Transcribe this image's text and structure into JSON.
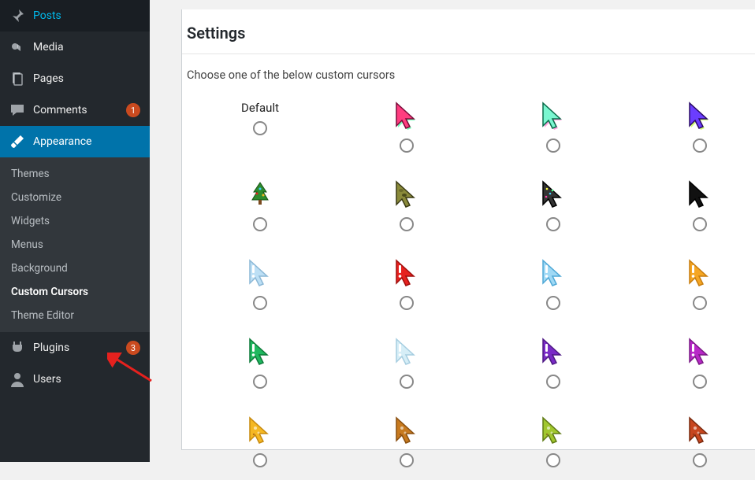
{
  "sidebar": {
    "posts": "Posts",
    "media": "Media",
    "pages": "Pages",
    "comments": "Comments",
    "comments_badge": "1",
    "appearance": "Appearance",
    "plugins": "Plugins",
    "plugins_badge": "3",
    "users": "Users",
    "submenu": {
      "themes": "Themes",
      "customize": "Customize",
      "widgets": "Widgets",
      "menus": "Menus",
      "background": "Background",
      "custom_cursors": "Custom Cursors",
      "theme_editor": "Theme Editor"
    }
  },
  "settings": {
    "title": "Settings",
    "subtitle": "Choose one of the below custom cursors",
    "default_label": "Default",
    "cursors": [
      {
        "id": "default",
        "label": "Default"
      },
      {
        "id": "pink-neon",
        "fill": "#ff3d7f",
        "stroke": "#7a0b3a",
        "shadow": "#3aff9e"
      },
      {
        "id": "mint-neon",
        "fill": "#7af7d0",
        "stroke": "#0b6b4a",
        "shadow": "#ff7ad0"
      },
      {
        "id": "purple-neon",
        "fill": "#6b3dff",
        "stroke": "#2a0b66",
        "shadow": "#bfff3a"
      },
      {
        "id": "tree",
        "fill": "#2e8b2e",
        "stroke": "#145214",
        "decor": "tree"
      },
      {
        "id": "camo",
        "fill": "#8a8a3a",
        "stroke": "#3a3a14",
        "decor": "camo"
      },
      {
        "id": "confetti",
        "fill": "#333333",
        "stroke": "#000000",
        "decor": "confetti"
      },
      {
        "id": "black",
        "fill": "#111111",
        "stroke": "#000000"
      },
      {
        "id": "ex-lightblue",
        "fill": "#bcdff5",
        "stroke": "#8cb8d6",
        "decor": "excl"
      },
      {
        "id": "ex-red",
        "fill": "#e6211e",
        "stroke": "#a00f0d",
        "decor": "excl"
      },
      {
        "id": "ex-sky",
        "fill": "#9fd9f5",
        "stroke": "#4fa8d6",
        "decor": "excl"
      },
      {
        "id": "ex-orange",
        "fill": "#f5a623",
        "stroke": "#c77d0f",
        "decor": "excl"
      },
      {
        "id": "ex-green",
        "fill": "#1fb85f",
        "stroke": "#0f7a3a",
        "decor": "excl"
      },
      {
        "id": "ex-pale",
        "fill": "#d6eef7",
        "stroke": "#a6cde0",
        "decor": "excl"
      },
      {
        "id": "ex-purple",
        "fill": "#7a2bc7",
        "stroke": "#4f1a85",
        "decor": "excl"
      },
      {
        "id": "ex-magenta",
        "fill": "#b828c7",
        "stroke": "#7a1a85",
        "decor": "excl"
      },
      {
        "id": "food-yellow",
        "fill": "#f5b823",
        "stroke": "#c78a0f",
        "decor": "food"
      },
      {
        "id": "food-fruit",
        "fill": "#c77a1f",
        "stroke": "#8a4f0f",
        "decor": "food"
      },
      {
        "id": "food-kiwi",
        "fill": "#a1c72e",
        "stroke": "#5f7a14",
        "decor": "food"
      },
      {
        "id": "food-choco",
        "fill": "#c7461f",
        "stroke": "#7a2a0f",
        "decor": "food"
      }
    ]
  }
}
